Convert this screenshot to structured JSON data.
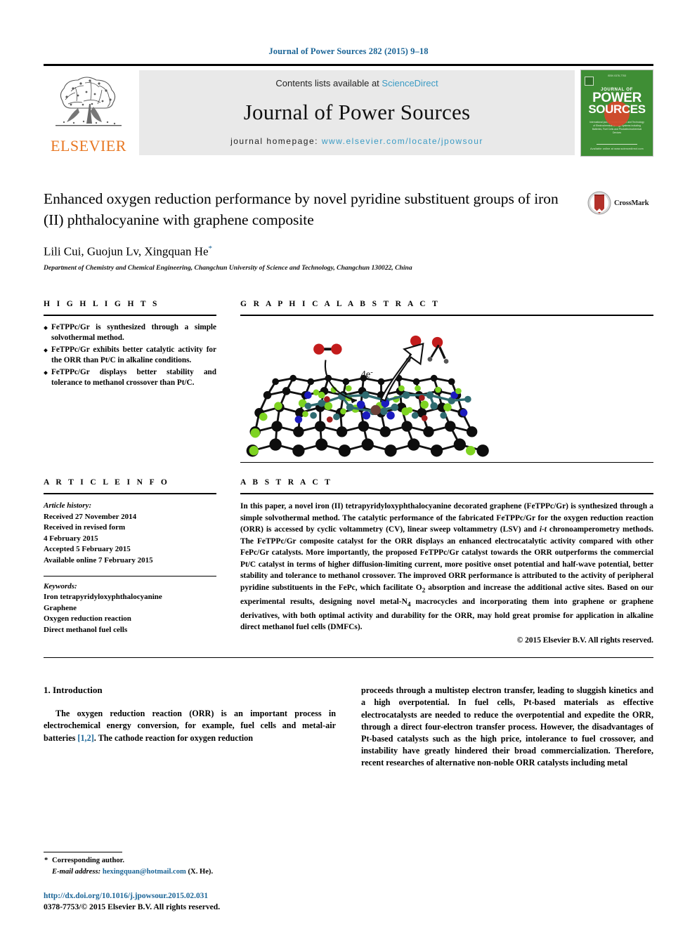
{
  "running_head": "Journal of Power Sources 282 (2015) 9–18",
  "masthead": {
    "publisher_name": "ELSEVIER",
    "contents_prefix": "Contents lists available at",
    "contents_link": "ScienceDirect",
    "journal_name": "Journal of Power Sources",
    "homepage_prefix": "journal homepage:",
    "homepage_url": "www.elsevier.com/locate/jpowsour",
    "cover": {
      "top_text": "ISSN 0378-7753",
      "line1": "JOURNAL OF",
      "line2": "POWER",
      "line3": "SOURCES",
      "subtitle": "International journal on the Science and Technology of Electrochemical Energy Systems including Batteries, Fuel Cells and Photoelectrochemical Devices",
      "bottom_text": "Available online at www.sciencedirect.com"
    }
  },
  "article": {
    "title": "Enhanced oxygen reduction performance by novel pyridine substituent groups of iron (II) phthalocyanine with graphene composite",
    "authors": "Lili Cui, Guojun Lv, Xingquan He",
    "corresponding_marker": "*",
    "affiliation": "Department of Chemistry and Chemical Engineering, Changchun University of Science and Technology, Changchun 130022, China",
    "crossmark_label": "CrossMark"
  },
  "highlights": {
    "heading": "H I G H L I G H T S",
    "items": [
      "FeTPPc/Gr is synthesized through a simple solvothermal method.",
      "FeTPPc/Gr exhibits better catalytic activity for the ORR than Pt/C in alkaline conditions.",
      "FeTPPc/Gr displays better stability and tolerance to methanol crossover than Pt/C."
    ]
  },
  "graphical_abstract": {
    "heading": "G R A P H I C A L   A B S T R A C T",
    "figure_label": "4e-"
  },
  "article_info": {
    "heading": "A R T I C L E   I N F O",
    "history_label": "Article history:",
    "history": [
      "Received 27 November 2014",
      "Received in revised form",
      "4 February 2015",
      "Accepted 5 February 2015",
      "Available online 7 February 2015"
    ],
    "keywords_label": "Keywords:",
    "keywords": [
      "Iron tetrapyridyloxyphthalocyanine",
      "Graphene",
      "Oxygen reduction reaction",
      "Direct methanol fuel cells"
    ]
  },
  "abstract": {
    "heading": "A B S T R A C T",
    "body": "In this paper, a novel iron (II) tetrapyridyloxyphthalocyanine decorated graphene (FeTPPc/Gr) is synthesized through a simple solvothermal method. The catalytic performance of the fabricated FeTPPc/Gr for the oxygen reduction reaction (ORR) is accessed by cyclic voltammetry (CV), linear sweep voltammetry (LSV) and i-t chronoamperometry methods. The FeTPPc/Gr composite catalyst for the ORR displays an enhanced electrocatalytic activity compared with other FePc/Gr catalysts. More importantly, the proposed FeTPPc/Gr catalyst towards the ORR outperforms the commercial Pt/C catalyst in terms of higher diffusion-limiting current, more positive onset potential and half-wave potential, better stability and tolerance to methanol crossover. The improved ORR performance is attributed to the activity of peripheral pyridine substituents in the FePc, which facilitate O2 absorption and increase the additional active sites. Based on our experimental results, designing novel metal-N4 macrocycles and incorporating them into graphene or graphene derivatives, with both optimal activity and durability for the ORR, may hold great promise for application in alkaline direct methanol fuel cells (DMFCs).",
    "copyright": "© 2015 Elsevier B.V. All rights reserved."
  },
  "introduction": {
    "heading": "1.  Introduction",
    "col_left": "The oxygen reduction reaction (ORR) is an important process in electrochemical energy conversion, for example, fuel cells and metal-air batteries [1,2]. The cathode reaction for oxygen reduction",
    "col_left_ref": "[1,2]",
    "col_right": "proceeds through a multistep electron transfer, leading to sluggish kinetics and a high overpotential. In fuel cells, Pt-based materials as effective electrocatalysts are needed to reduce the overpotential and expedite the ORR, through a direct four-electron transfer process. However, the disadvantages of Pt-based catalysts such as the high price, intolerance to fuel crossover, and instability have greatly hindered their broad commercialization. Therefore, recent researches of alternative non-noble ORR catalysts including metal"
  },
  "footer": {
    "corresponding_marker": "*",
    "corresponding_label": "Corresponding author.",
    "email_label": "E-mail address:",
    "email": "hexingquan@hotmail.com",
    "email_suffix": "(X. He).",
    "doi": "http://dx.doi.org/10.1016/j.jpowsour.2015.02.031",
    "issn_line": "0378-7753/© 2015 Elsevier B.V. All rights reserved."
  },
  "colors": {
    "link_blue": "#1a6496",
    "sciencedirect_blue": "#3b9bc4",
    "elsevier_orange": "#E87722",
    "cover_green": "#3f8e35",
    "crossmark_red": "#b3312a"
  }
}
